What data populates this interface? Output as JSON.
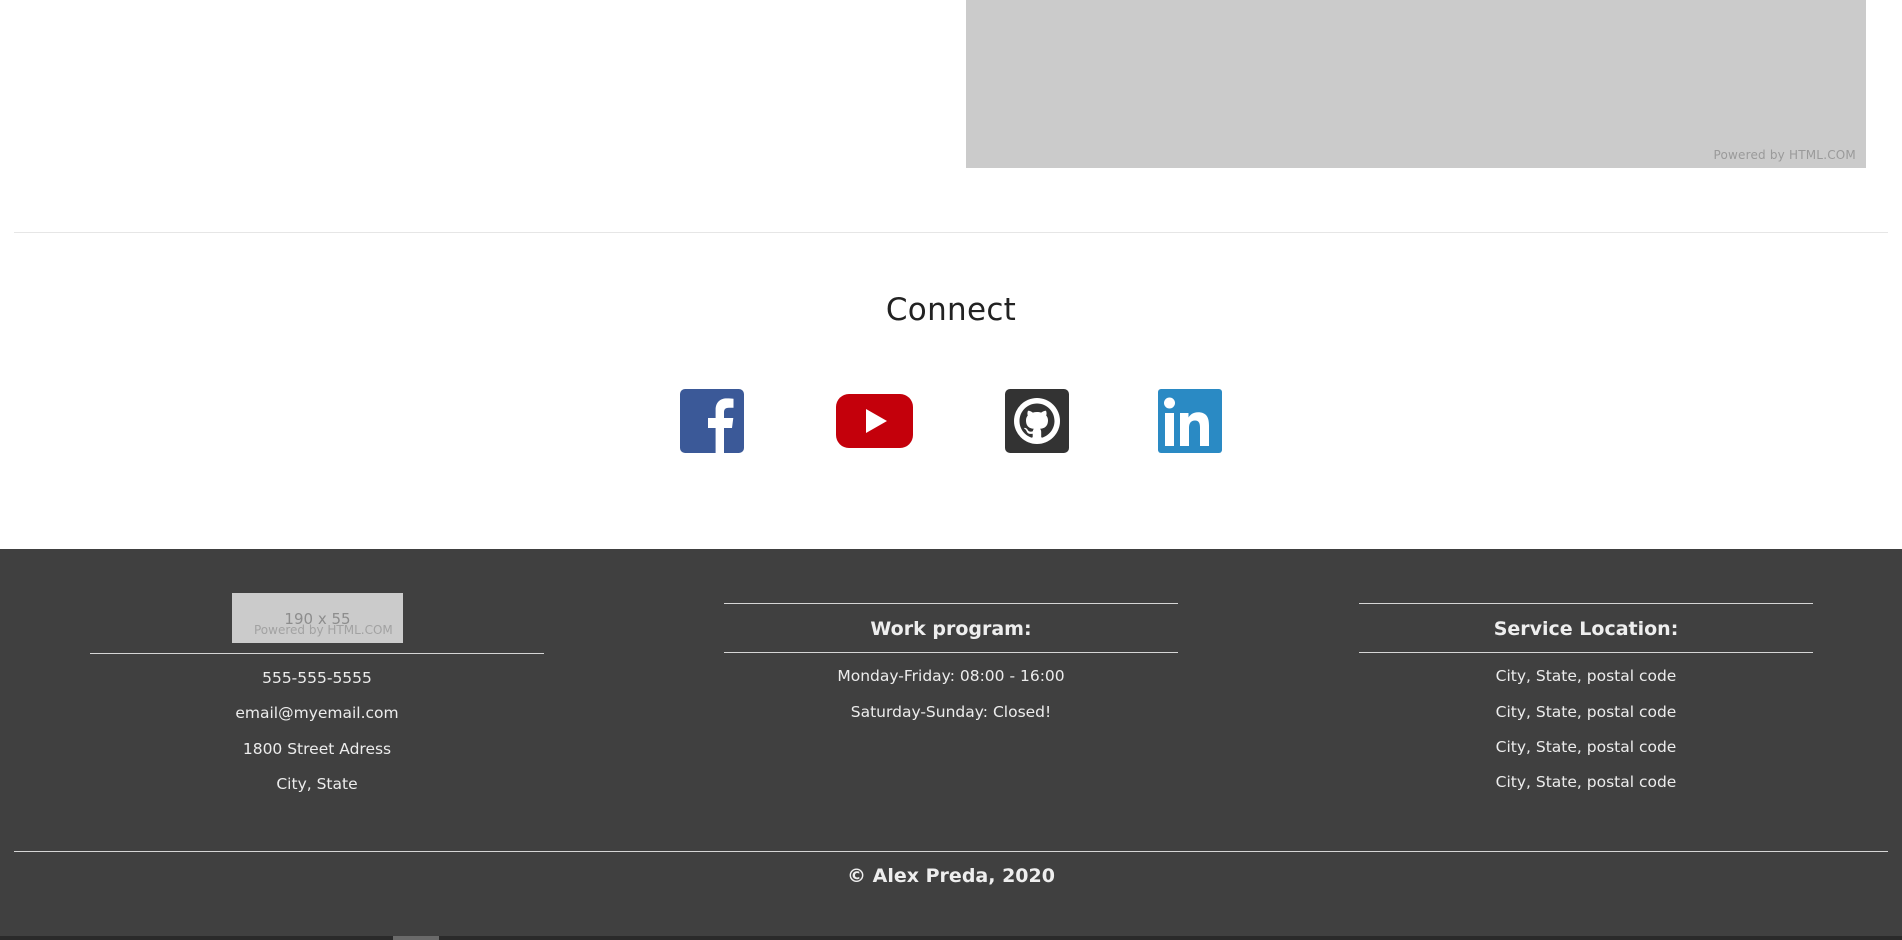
{
  "top_image": {
    "powered_text": "Powered by HTML.COM"
  },
  "connect": {
    "title": "Connect",
    "links": [
      {
        "name": "Facebook",
        "icon": "facebook-icon",
        "color": "#3b5998"
      },
      {
        "name": "YouTube",
        "icon": "youtube-icon",
        "color": "#c4302b"
      },
      {
        "name": "GitHub",
        "icon": "github-icon",
        "color": "#333333"
      },
      {
        "name": "LinkedIn",
        "icon": "linkedin-icon",
        "color": "#2a8ac4"
      }
    ]
  },
  "footer": {
    "logo": {
      "size_text": "190 x 55",
      "powered_text": "Powered by HTML.COM"
    },
    "contact": {
      "phone": "555-555-5555",
      "email": "email@myemail.com",
      "address": "1800 Street Adress",
      "city": "City, State"
    },
    "work_program": {
      "heading": "Work program:",
      "lines": [
        "Monday-Friday: 08:00 - 16:00",
        "Saturday-Sunday: Closed!"
      ]
    },
    "service_location": {
      "heading": "Service Location:",
      "lines": [
        "City, State, postal code",
        "City, State, postal code",
        "City, State, postal code",
        "City, State, postal code"
      ]
    },
    "copyright": "© Alex Preda, 2020"
  },
  "colors": {
    "footer_bg": "#404040",
    "placeholder": "#cbcbcb"
  }
}
